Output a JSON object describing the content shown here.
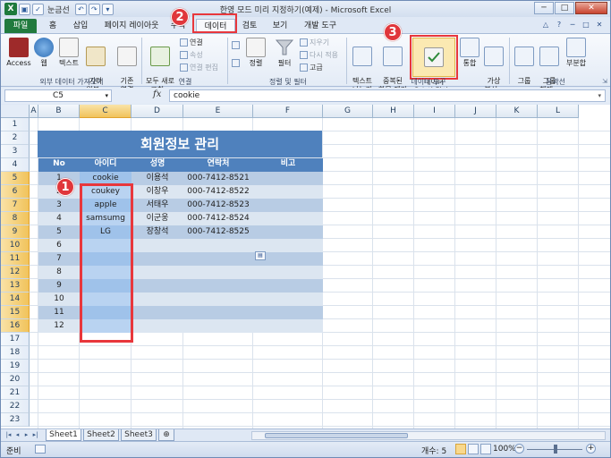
{
  "window": {
    "title": "한영 모드 미리 지정하기(예제) - Microsoft Excel",
    "qat_text": "눈금선",
    "min": "─",
    "max": "□",
    "close": "✕"
  },
  "tabs": {
    "file": "파일",
    "items": [
      "홈",
      "삽입",
      "페이지 레이아웃",
      "수식",
      "데이터",
      "검토",
      "보기",
      "개발 도구"
    ]
  },
  "ribbon": {
    "ext_group": {
      "access": "Access",
      "web": "웹",
      "text": "텍스트",
      "other": "기타\n원본 ▾",
      "existing": "기존\n연결",
      "label": "외부 데이터 가져오기"
    },
    "conn_group": {
      "refresh_all": "모두 새로\n고침 ▾",
      "connections": "연결",
      "properties": "속성",
      "edit_links": "연결 편집",
      "label": "연결"
    },
    "sort_group": {
      "sort_az": "",
      "sort": "정렬",
      "filter": "필터",
      "clear": "지우기",
      "reapply": "다시 적용",
      "advanced": "고급",
      "label": "정렬 및 필터"
    },
    "tools_group": {
      "text_to_cols": "텍스트\n나누기",
      "remove_dup": "중복된\n항목 제거",
      "validation": "데이터\n유효성 검사 ▾",
      "consolidate": "통합",
      "whatif": "가상\n분석 ▾",
      "label": "데이터 도구"
    },
    "outline_group": {
      "group": "그룹\n▾",
      "ungroup": "그룹\n해제 ▾",
      "subtotal": "부분합",
      "label": "윤곽선"
    }
  },
  "formula_bar": {
    "name_box": "C5",
    "fx": "fx",
    "value": "cookie"
  },
  "columns": [
    "A",
    "B",
    "C",
    "D",
    "E",
    "F",
    "G",
    "H",
    "I",
    "J",
    "K",
    "L"
  ],
  "rows": [
    "1",
    "2",
    "3",
    "4",
    "5",
    "6",
    "7",
    "8",
    "9",
    "10",
    "11",
    "12",
    "13",
    "14",
    "15",
    "16",
    "17",
    "18",
    "19",
    "20",
    "21",
    "22",
    "23"
  ],
  "sheet": {
    "banner": "회원정보 관리",
    "headers": [
      "No",
      "아이디",
      "성명",
      "연락처",
      "비고"
    ],
    "data": [
      [
        "1",
        "cookie",
        "이용석",
        "000-7412-8521",
        ""
      ],
      [
        "2",
        "coukey",
        "이창우",
        "000-7412-8522",
        ""
      ],
      [
        "3",
        "apple",
        "서태우",
        "000-7412-8523",
        ""
      ],
      [
        "4",
        "samsumg",
        "이군웅",
        "000-7412-8524",
        ""
      ],
      [
        "5",
        "LG",
        "장창석",
        "000-7412-8525",
        ""
      ],
      [
        "6",
        "",
        "",
        "",
        ""
      ],
      [
        "7",
        "",
        "",
        "",
        ""
      ],
      [
        "8",
        "",
        "",
        "",
        ""
      ],
      [
        "9",
        "",
        "",
        "",
        ""
      ],
      [
        "10",
        "",
        "",
        "",
        ""
      ],
      [
        "11",
        "",
        "",
        "",
        ""
      ],
      [
        "12",
        "",
        "",
        "",
        ""
      ]
    ]
  },
  "badges": [
    "1",
    "2",
    "3"
  ],
  "sheet_tabs": [
    "Sheet1",
    "Sheet2",
    "Sheet3"
  ],
  "status": {
    "ready": "준비",
    "count": "개수: 5",
    "zoom": "100%"
  }
}
